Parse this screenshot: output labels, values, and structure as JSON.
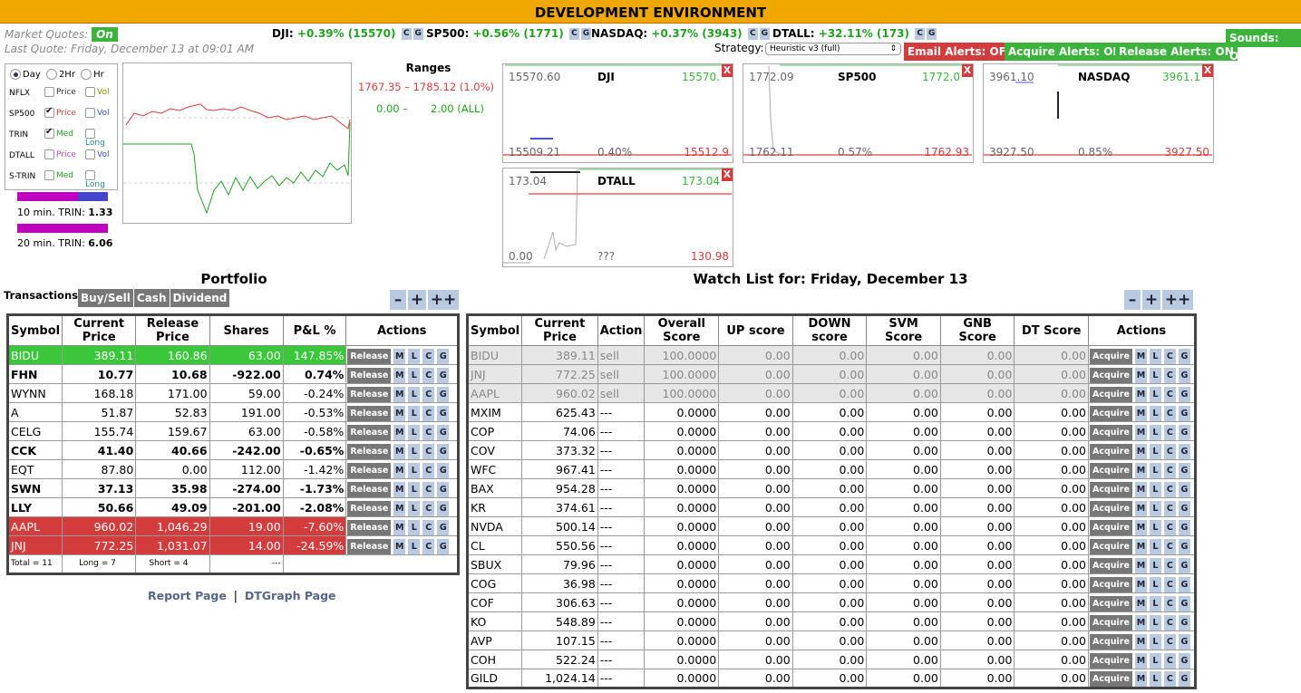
{
  "env_title": "DEVELOPMENT ENVIRONMENT",
  "market": {
    "label": "Market Quotes:",
    "status": "On",
    "last_quote": "Last Quote: Friday, December 13 at 09:01 AM"
  },
  "quotes": [
    {
      "name": "DJI:",
      "change": "+0.39% (15570)"
    },
    {
      "name": "SP500:",
      "change": "+0.56% (1771)"
    },
    {
      "name": "NASDAQ:",
      "change": "+0.37% (3943)"
    },
    {
      "name": "DTALL:",
      "change": "+32.11% (173)"
    }
  ],
  "cg": {
    "c": "C",
    "g": "G"
  },
  "strategy": {
    "label": "Strategy:",
    "value": "Heuristic v3 (full)"
  },
  "alerts": {
    "email": "Email Alerts: OFF",
    "acquire": "Acquire Alerts: ON",
    "release": "Release Alerts: ON",
    "sounds": "Sounds: ON"
  },
  "controls": {
    "ranges": [
      {
        "label": "Day",
        "on": true
      },
      {
        "label": "2Hr",
        "on": false
      },
      {
        "label": "Hr",
        "on": false
      }
    ],
    "rows": [
      {
        "sym": "NFLX",
        "a": "Price",
        "b": "Vol",
        "a_on": false,
        "b_on": false,
        "a_color": "#333",
        "b_color": "#8a8a00"
      },
      {
        "sym": "SP500",
        "a": "Price",
        "b": "Vol",
        "a_on": true,
        "b_on": false,
        "a_color": "#d23c3c",
        "b_color": "#3355bb"
      },
      {
        "sym": "TRIN",
        "a": "Med",
        "b": "Long",
        "a_on": true,
        "b_on": false,
        "a_color": "#22a022",
        "b_color": "#228888"
      },
      {
        "sym": "DTALL",
        "a": "Price",
        "b": "Vol",
        "a_on": false,
        "b_on": false,
        "a_color": "#c040c0",
        "b_color": "#3355bb"
      },
      {
        "sym": "S-TRIN",
        "a": "Med",
        "b": "Long",
        "a_on": false,
        "b_on": false,
        "a_color": "#22a022",
        "b_color": "#228888"
      }
    ],
    "trin10_label": "10 min. TRIN:",
    "trin10": "1.33",
    "trin10_fill": 0.67,
    "trin20_label": "20 min. TRIN:",
    "trin20": "6.06",
    "trin20_fill": 1.0
  },
  "ranges_panel": {
    "title": "Ranges",
    "line1": "1767.35 – 1785.12 (1.0%)",
    "line2a": "0.00 –",
    "line2b": "2.00  (ALL)"
  },
  "minis": [
    {
      "name": "DJI",
      "tl": "15570.60",
      "tr": "15570.",
      "bl": "15509.21",
      "bm": "0.40%",
      "br": "15512.9"
    },
    {
      "name": "SP500",
      "tl": "1772.09",
      "tr": "1772.0",
      "bl": "1762.11",
      "bm": "0.57%",
      "br": "1762.93"
    },
    {
      "name": "NASDAQ",
      "tl": "3961.10",
      "tr": "3961.1",
      "bl": "3927.50",
      "bm": "0.85%",
      "br": "3927.50"
    },
    {
      "name": "DTALL",
      "tl": "173.04",
      "tr": "173.04",
      "bl": "0.00",
      "bm": "???",
      "br": "130.98"
    }
  ],
  "x_label": "X",
  "portfolio": {
    "title": "Portfolio",
    "transactions_label": "Transactions:",
    "tabs": [
      "Buy/Sell",
      "Cash",
      "Dividend"
    ],
    "zoom": [
      "–",
      "+",
      "++"
    ],
    "headers": [
      "Symbol",
      "Current Price",
      "Release Price",
      "Shares",
      "P&L %",
      "Actions"
    ],
    "action_label": "Release",
    "mini_actions": [
      "M",
      "L",
      "C",
      "G"
    ],
    "rows": [
      {
        "s": "BIDU",
        "c": "389.11",
        "r": "160.86",
        "sh": "63.00",
        "pl": "147.85%",
        "k": "gr"
      },
      {
        "s": "FHN",
        "c": "10.77",
        "r": "10.68",
        "sh": "-922.00",
        "pl": "0.74%",
        "k": "bold"
      },
      {
        "s": "WYNN",
        "c": "168.18",
        "r": "171.00",
        "sh": "59.00",
        "pl": "-0.24%",
        "k": ""
      },
      {
        "s": "A",
        "c": "51.87",
        "r": "52.83",
        "sh": "191.00",
        "pl": "-0.53%",
        "k": ""
      },
      {
        "s": "CELG",
        "c": "155.74",
        "r": "159.67",
        "sh": "63.00",
        "pl": "-0.58%",
        "k": ""
      },
      {
        "s": "CCK",
        "c": "41.40",
        "r": "40.66",
        "sh": "-242.00",
        "pl": "-0.65%",
        "k": "bold"
      },
      {
        "s": "EQT",
        "c": "87.80",
        "r": "0.00",
        "sh": "112.00",
        "pl": "-1.42%",
        "k": ""
      },
      {
        "s": "SWN",
        "c": "37.13",
        "r": "35.98",
        "sh": "-274.00",
        "pl": "-1.73%",
        "k": "bold"
      },
      {
        "s": "LLY",
        "c": "50.66",
        "r": "49.09",
        "sh": "-201.00",
        "pl": "-2.08%",
        "k": "bold"
      },
      {
        "s": "AAPL",
        "c": "960.02",
        "r": "1,046.29",
        "sh": "19.00",
        "pl": "-7.60%",
        "k": "rr"
      },
      {
        "s": "JNJ",
        "c": "772.25",
        "r": "1,031.07",
        "sh": "14.00",
        "pl": "-24.59%",
        "k": "rr"
      }
    ],
    "footer": {
      "total": "Total = 11",
      "long": "Long = 7",
      "short": "Short = 4",
      "pl": "---"
    },
    "links": [
      "Report Page",
      "DTGraph Page"
    ],
    "sep": "|"
  },
  "watch": {
    "title": "Watch List for: Friday, December 13",
    "zoom": [
      "–",
      "+",
      "++"
    ],
    "headers": [
      "Symbol",
      "Current Price",
      "Action",
      "Overall Score",
      "UP score",
      "DOWN score",
      "SVM Score",
      "GNB Score",
      "DT Score",
      "Actions"
    ],
    "action_label": "Acquire",
    "mini_actions": [
      "M",
      "L",
      "C",
      "G"
    ],
    "rows": [
      {
        "s": "BIDU",
        "c": "389.11",
        "a": "sell",
        "o": "100.0000",
        "u": "0.00",
        "d": "0.00",
        "sv": "0.00",
        "g": "0.00",
        "dt": "0.00",
        "k": "lg"
      },
      {
        "s": "JNJ",
        "c": "772.25",
        "a": "sell",
        "o": "100.0000",
        "u": "0.00",
        "d": "0.00",
        "sv": "0.00",
        "g": "0.00",
        "dt": "0.00",
        "k": "lg"
      },
      {
        "s": "AAPL",
        "c": "960.02",
        "a": "sell",
        "o": "100.0000",
        "u": "0.00",
        "d": "0.00",
        "sv": "0.00",
        "g": "0.00",
        "dt": "0.00",
        "k": "lg"
      },
      {
        "s": "MXIM",
        "c": "625.43",
        "a": "---",
        "o": "0.0000",
        "u": "0.00",
        "d": "0.00",
        "sv": "0.00",
        "g": "0.00",
        "dt": "0.00",
        "k": ""
      },
      {
        "s": "COP",
        "c": "74.06",
        "a": "---",
        "o": "0.0000",
        "u": "0.00",
        "d": "0.00",
        "sv": "0.00",
        "g": "0.00",
        "dt": "0.00",
        "k": ""
      },
      {
        "s": "COV",
        "c": "373.32",
        "a": "---",
        "o": "0.0000",
        "u": "0.00",
        "d": "0.00",
        "sv": "0.00",
        "g": "0.00",
        "dt": "0.00",
        "k": ""
      },
      {
        "s": "WFC",
        "c": "967.41",
        "a": "---",
        "o": "0.0000",
        "u": "0.00",
        "d": "0.00",
        "sv": "0.00",
        "g": "0.00",
        "dt": "0.00",
        "k": ""
      },
      {
        "s": "BAX",
        "c": "954.28",
        "a": "---",
        "o": "0.0000",
        "u": "0.00",
        "d": "0.00",
        "sv": "0.00",
        "g": "0.00",
        "dt": "0.00",
        "k": ""
      },
      {
        "s": "KR",
        "c": "374.61",
        "a": "---",
        "o": "0.0000",
        "u": "0.00",
        "d": "0.00",
        "sv": "0.00",
        "g": "0.00",
        "dt": "0.00",
        "k": ""
      },
      {
        "s": "NVDA",
        "c": "500.14",
        "a": "---",
        "o": "0.0000",
        "u": "0.00",
        "d": "0.00",
        "sv": "0.00",
        "g": "0.00",
        "dt": "0.00",
        "k": ""
      },
      {
        "s": "CL",
        "c": "550.56",
        "a": "---",
        "o": "0.0000",
        "u": "0.00",
        "d": "0.00",
        "sv": "0.00",
        "g": "0.00",
        "dt": "0.00",
        "k": ""
      },
      {
        "s": "SBUX",
        "c": "79.96",
        "a": "---",
        "o": "0.0000",
        "u": "0.00",
        "d": "0.00",
        "sv": "0.00",
        "g": "0.00",
        "dt": "0.00",
        "k": ""
      },
      {
        "s": "COG",
        "c": "36.98",
        "a": "---",
        "o": "0.0000",
        "u": "0.00",
        "d": "0.00",
        "sv": "0.00",
        "g": "0.00",
        "dt": "0.00",
        "k": ""
      },
      {
        "s": "COF",
        "c": "306.63",
        "a": "---",
        "o": "0.0000",
        "u": "0.00",
        "d": "0.00",
        "sv": "0.00",
        "g": "0.00",
        "dt": "0.00",
        "k": ""
      },
      {
        "s": "KO",
        "c": "548.89",
        "a": "---",
        "o": "0.0000",
        "u": "0.00",
        "d": "0.00",
        "sv": "0.00",
        "g": "0.00",
        "dt": "0.00",
        "k": ""
      },
      {
        "s": "AVP",
        "c": "107.15",
        "a": "---",
        "o": "0.0000",
        "u": "0.00",
        "d": "0.00",
        "sv": "0.00",
        "g": "0.00",
        "dt": "0.00",
        "k": ""
      },
      {
        "s": "COH",
        "c": "522.24",
        "a": "---",
        "o": "0.0000",
        "u": "0.00",
        "d": "0.00",
        "sv": "0.00",
        "g": "0.00",
        "dt": "0.00",
        "k": ""
      },
      {
        "s": "GILD",
        "c": "1,024.14",
        "a": "---",
        "o": "0.0000",
        "u": "0.00",
        "d": "0.00",
        "sv": "0.00",
        "g": "0.00",
        "dt": "0.00",
        "k": ""
      }
    ]
  },
  "colors": {
    "env_bar": "#f0a800",
    "green": "#3cb43c",
    "red": "#d23c3c",
    "action_gray": "#777777",
    "mini_btn": "#b9c9e0"
  }
}
